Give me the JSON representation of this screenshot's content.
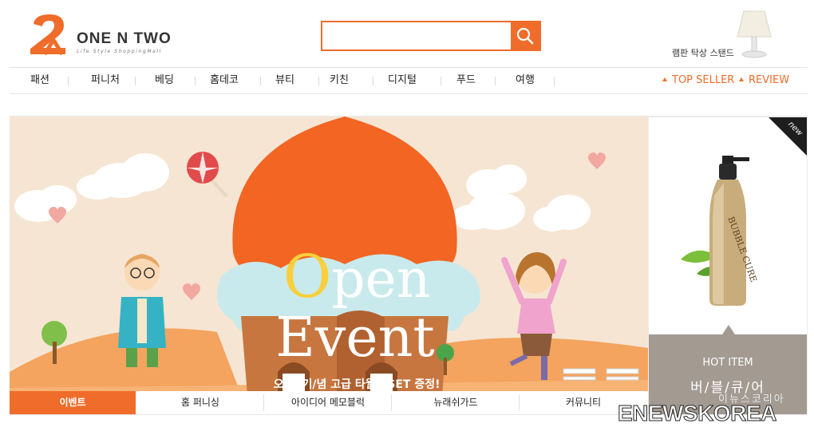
{
  "header": {
    "brand_name": "ONE N TWO",
    "brand_tagline": "Life Style ShoppingMall",
    "logo_numeral": "2",
    "search_placeholder": "",
    "promo_label": "램판 탁상 스탠드"
  },
  "nav": {
    "items": [
      "패션",
      "퍼니처",
      "베딩",
      "홈데코",
      "뷰티",
      "키친",
      "디지털",
      "푸드",
      "여행"
    ],
    "top_seller": "TOP SELLER",
    "review": "REVIEW"
  },
  "banner": {
    "open_first": "O",
    "open_rest": "pen",
    "event": "Event",
    "promo_text": "오/픈/기/념 고급 타월 2SET 증정!",
    "tabs": [
      "이벤트",
      "홈 퍼니싱",
      "아이디어 메모블럭",
      "뉴래쉬가드",
      "커뮤니티"
    ],
    "active_tab": 0
  },
  "hot_item": {
    "ribbon": "new",
    "title": "HOT ITEM",
    "name": "버/블/큐/어",
    "bottle_text": "BUBBLE CURE"
  },
  "watermark": {
    "korean": "이뉴스코리아",
    "english": "ENEWSKOREA"
  },
  "colors": {
    "accent": "#ef6c2a",
    "hot_panel": "#a39a92",
    "banner_bg": "#f6e5d3"
  },
  "icons": {
    "search": "search-icon",
    "lamp": "lamp-icon",
    "bottle": "bottle-icon"
  }
}
